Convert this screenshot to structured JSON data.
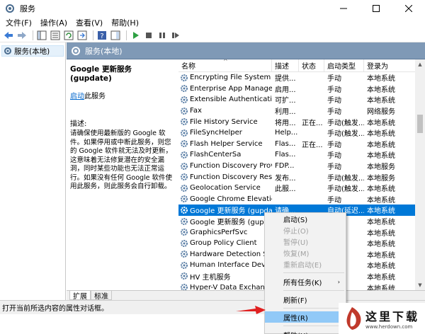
{
  "window": {
    "title": "服务",
    "controls": [
      "minimize",
      "maximize",
      "close"
    ]
  },
  "menu": [
    "文件(F)",
    "操作(A)",
    "查看(V)",
    "帮助(H)"
  ],
  "toolbar": {
    "icons": [
      "back-icon",
      "forward-icon",
      "console-tree-icon",
      "properties-list-icon",
      "refresh-icon",
      "export-icon",
      "help-icon",
      "show-pane-icon",
      "start-icon",
      "stop-icon",
      "pause-icon",
      "restart-icon"
    ]
  },
  "tree": {
    "selected_label": "服务(本地)"
  },
  "main_header": {
    "title": "服务(本地)"
  },
  "description_panel": {
    "title": "Google 更新服务 (gupdate)",
    "link": "启动",
    "link_suffix": "此服务",
    "label": "描述:",
    "body": "请确保使用最新版的 Google 软件。如果停用或中断此服务，则您的 Google 软件就无法及时更新，这意味着无法修复潜在的安全漏洞，同时某些功能也无法正常运行。如果没有任何 Google 软件使用此服务，则此服务会自行卸载。"
  },
  "columns": {
    "name": "名称",
    "description": "描述",
    "status": "状态",
    "startup": "启动类型",
    "logon": "登录为"
  },
  "services": [
    {
      "name": "Encrypting File System (E...",
      "description": "提供...",
      "status": "",
      "startup": "手动",
      "logon": "本地系统"
    },
    {
      "name": "Enterprise App Manage...",
      "description": "启用...",
      "status": "",
      "startup": "手动",
      "logon": "本地系统"
    },
    {
      "name": "Extensible Authenticati...",
      "description": "可扩...",
      "status": "",
      "startup": "手动",
      "logon": "本地系统"
    },
    {
      "name": "Fax",
      "description": "利用...",
      "status": "",
      "startup": "手动",
      "logon": "网络服务"
    },
    {
      "name": "File History Service",
      "description": "将用...",
      "status": "正在...",
      "startup": "手动(触发...",
      "logon": "本地系统"
    },
    {
      "name": "FileSyncHelper",
      "description": "Help...",
      "status": "",
      "startup": "手动(触发...",
      "logon": "本地系统"
    },
    {
      "name": "Flash Helper Service",
      "description": "Flas...",
      "status": "正在...",
      "startup": "手动",
      "logon": "本地系统"
    },
    {
      "name": "FlashCenterSa",
      "description": "Flas...",
      "status": "",
      "startup": "手动",
      "logon": "本地系统"
    },
    {
      "name": "Function Discovery Provi...",
      "description": "FDP...",
      "status": "",
      "startup": "手动",
      "logon": "本地服务"
    },
    {
      "name": "Function Discovery Reso...",
      "description": "发布...",
      "status": "",
      "startup": "手动(触发...",
      "logon": "本地服务"
    },
    {
      "name": "Geolocation Service",
      "description": "此服...",
      "status": "",
      "startup": "手动(触发...",
      "logon": "本地系统"
    },
    {
      "name": "Google Chrome Elevatio...",
      "description": "",
      "status": "",
      "startup": "手动",
      "logon": "本地系统"
    },
    {
      "name": "Google 更新服务 (gupdate)",
      "description": "请确...",
      "status": "",
      "startup": "自动(延迟...",
      "logon": "本地系统",
      "selected": true
    },
    {
      "name": "Google 更新服务 (gupda...",
      "description": "",
      "status": "",
      "startup": "",
      "logon": "本地系统"
    },
    {
      "name": "GraphicsPerfSvc",
      "description": "",
      "status": "",
      "startup": "",
      "logon": "本地系统"
    },
    {
      "name": "Group Policy Client",
      "description": "",
      "status": "",
      "startup": "",
      "logon": "本地系统"
    },
    {
      "name": "Hardware Detection Se...",
      "description": "",
      "status": "",
      "startup": "",
      "logon": "本地系统"
    },
    {
      "name": "Human Interface Device...",
      "description": "",
      "status": "",
      "startup": "",
      "logon": "本地系统"
    },
    {
      "name": "HV 主机服务",
      "description": "",
      "status": "",
      "startup": "",
      "logon": "本地系统"
    },
    {
      "name": "Hyper-V Data Exchange...",
      "description": "",
      "status": "",
      "startup": "",
      "logon": "本地系统"
    }
  ],
  "context_menu": {
    "items": [
      {
        "label": "启动(S)",
        "disabled": false
      },
      {
        "label": "停止(O)",
        "disabled": true
      },
      {
        "label": "暂停(U)",
        "disabled": true
      },
      {
        "label": "恢复(M)",
        "disabled": true
      },
      {
        "label": "重新启动(E)",
        "disabled": true
      },
      {
        "separator": true
      },
      {
        "label": "所有任务(K)",
        "submenu": true
      },
      {
        "separator": true
      },
      {
        "label": "刷新(F)"
      },
      {
        "separator": true
      },
      {
        "label": "属性(R)",
        "highlighted": true
      },
      {
        "separator": true
      },
      {
        "label": "帮助(H)"
      }
    ]
  },
  "tabs": [
    "扩展",
    "标准"
  ],
  "statusbar": {
    "text": "打开当前所选内容的属性对话框。"
  },
  "watermark": {
    "title": "这里下载",
    "url": "www.herdown.com"
  },
  "colors": {
    "selection": "#0078d7",
    "header": "#7f99b6",
    "menu_hover": "#91c9f7",
    "arrow": "#e02020"
  }
}
